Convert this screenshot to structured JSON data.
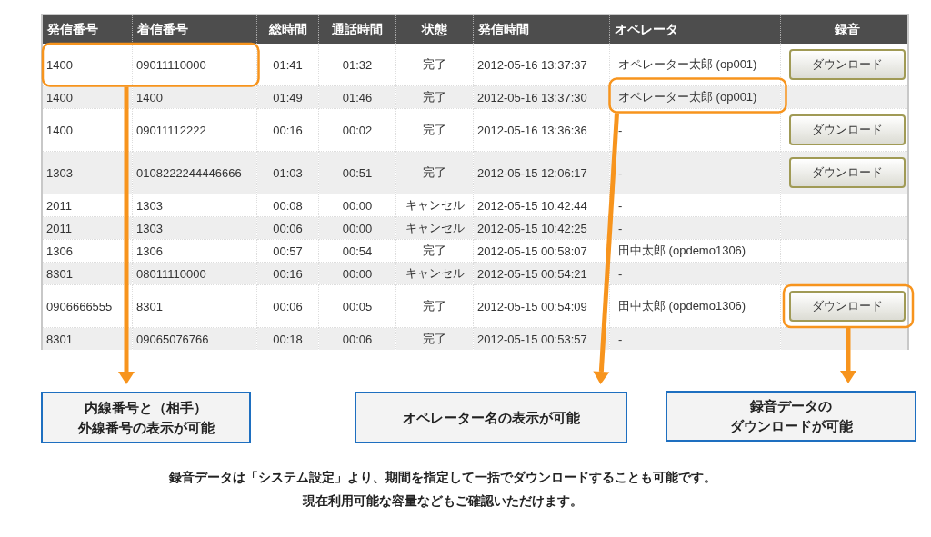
{
  "table": {
    "columns": [
      "発信番号",
      "着信番号",
      "総時間",
      "通話時間",
      "状態",
      "発信時間",
      "オペレータ",
      "録音"
    ],
    "rows": [
      {
        "cells": [
          "1400",
          "09011110000",
          "01:41",
          "01:32",
          "完了",
          "2012-05-16 13:37:37",
          "オペレーター太郎 (op001)"
        ],
        "recording": "ダウンロード"
      },
      {
        "cells": [
          "1400",
          "1400",
          "01:49",
          "01:46",
          "完了",
          "2012-05-16 13:37:30",
          "オペレーター太郎 (op001)"
        ]
      },
      {
        "cells": [
          "1400",
          "09011112222",
          "00:16",
          "00:02",
          "完了",
          "2012-05-16 13:36:36",
          "-"
        ],
        "recording": "ダウンロード"
      },
      {
        "cells": [
          "1303",
          "0108222244446666",
          "01:03",
          "00:51",
          "完了",
          "2012-05-15 12:06:17",
          "-"
        ],
        "recording": "ダウンロード"
      },
      {
        "cells": [
          "2011",
          "1303",
          "00:08",
          "00:00",
          "キャンセル",
          "2012-05-15 10:42:44",
          "-"
        ]
      },
      {
        "cells": [
          "2011",
          "1303",
          "00:06",
          "00:00",
          "キャンセル",
          "2012-05-15 10:42:25",
          "-"
        ]
      },
      {
        "cells": [
          "1306",
          "1306",
          "00:57",
          "00:54",
          "完了",
          "2012-05-15 00:58:07",
          "田中太郎 (opdemo1306)"
        ]
      },
      {
        "cells": [
          "8301",
          "08011110000",
          "00:16",
          "00:00",
          "キャンセル",
          "2012-05-15 00:54:21",
          "-"
        ]
      },
      {
        "cells": [
          "0906666555",
          "8301",
          "00:06",
          "00:05",
          "完了",
          "2012-05-15 00:54:09",
          "田中太郎 (opdemo1306)"
        ],
        "recording": "ダウンロード"
      },
      {
        "cells": [
          "8301",
          "09065076766",
          "00:18",
          "00:06",
          "完了",
          "2012-05-15 00:53:57",
          "-"
        ]
      }
    ]
  },
  "callouts": [
    {
      "lines": [
        "内線番号と（相手）",
        "外線番号の表示が可能"
      ]
    },
    {
      "lines": [
        "オペレーター名の表示が可能"
      ]
    },
    {
      "lines": [
        "録音データの",
        "ダウンロードが可能"
      ]
    }
  ],
  "note": [
    "録音データは「システム設定」より、期間を指定して一括でダウンロードすることも可能です。",
    "現在利用可能な容量などもご確認いただけます。"
  ]
}
